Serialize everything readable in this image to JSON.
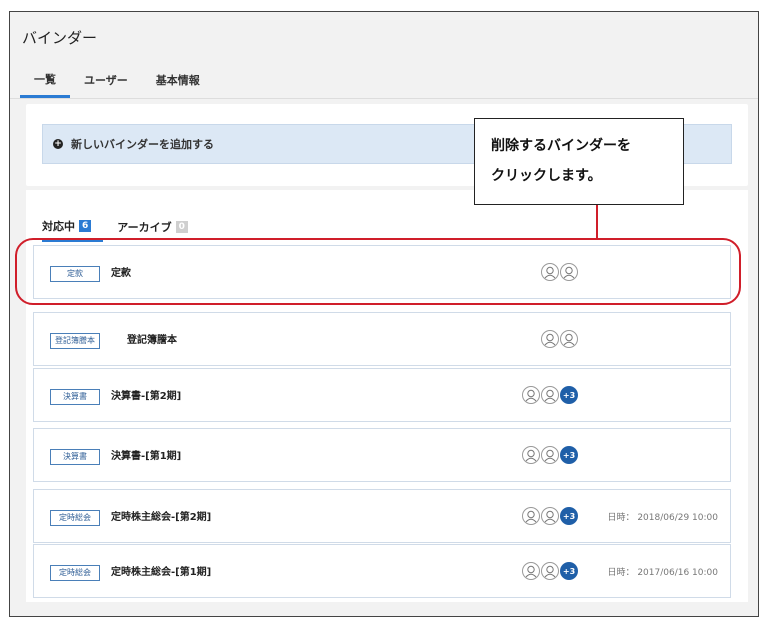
{
  "window": {
    "title": "バインダー"
  },
  "tabs": [
    {
      "label": "一覧",
      "active": true
    },
    {
      "label": "ユーザー",
      "active": false
    },
    {
      "label": "基本情報",
      "active": false
    }
  ],
  "add_binder": {
    "label": "新しいバインダーを追加する"
  },
  "subtabs": [
    {
      "label": "対応中",
      "count": "6",
      "active": true
    },
    {
      "label": "アーカイブ",
      "count": "0",
      "active": false
    }
  ],
  "binders": [
    {
      "badge": "定款",
      "name": "定款",
      "avatars": 2,
      "extra": "",
      "date": ""
    },
    {
      "badge": "登記簿謄本",
      "name": "登記簿謄本",
      "avatars": 2,
      "extra": "",
      "date": ""
    },
    {
      "badge": "決算書",
      "name": "決算書-[第2期]",
      "avatars": 2,
      "extra": "+3",
      "date": ""
    },
    {
      "badge": "決算書",
      "name": "決算書-[第1期]",
      "avatars": 2,
      "extra": "+3",
      "date": ""
    },
    {
      "badge": "定時総会",
      "name": "定時株主総会-[第2期]",
      "avatars": 2,
      "extra": "+3",
      "date": "日時： 2018/06/29 10:00"
    },
    {
      "badge": "定時総会",
      "name": "定時株主総会-[第1期]",
      "avatars": 2,
      "extra": "+3",
      "date": "日時： 2017/06/16 10:00"
    }
  ],
  "callout": {
    "line1": "削除するバインダーを",
    "line2": "クリックします。"
  },
  "colors": {
    "accent": "#2b7bd3",
    "highlight": "#d01e2a",
    "add_bar": "#dce8f5"
  }
}
